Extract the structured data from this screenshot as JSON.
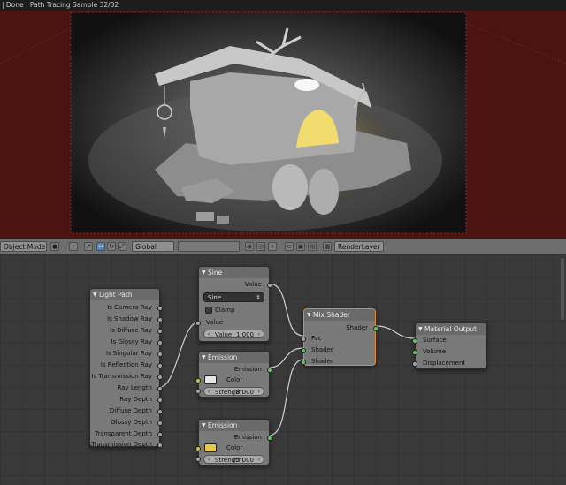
{
  "status_bar": {
    "text": "| Done | Path Tracing Sample 32/32"
  },
  "header": {
    "mode": "Object Mode",
    "orientation": "Global",
    "render_layer": "RenderLayer"
  },
  "nodes": {
    "light_path": {
      "title": "Light Path",
      "outputs": [
        "Is Camera Ray",
        "Is Shadow Ray",
        "Is Diffuse Ray",
        "Is Glossy Ray",
        "Is Singular Ray",
        "Is Reflection Ray",
        "Is Transmission Ray",
        "Ray Length",
        "Ray Depth",
        "Diffuse Depth",
        "Glossy Depth",
        "Transparent Depth",
        "Transmission Depth"
      ]
    },
    "sine": {
      "title": "Sine",
      "output_label": "Value",
      "operation": "Sine",
      "clamp_label": "Clamp",
      "input_label": "Value",
      "value_label": "Value:",
      "value": "1.000"
    },
    "emission1": {
      "title": "Emission",
      "output_label": "Emission",
      "color_label": "Color",
      "strength_label": "Strength:",
      "strength": "8.000",
      "color": "#e6e6e6"
    },
    "emission2": {
      "title": "Emission",
      "output_label": "Emission",
      "color_label": "Color",
      "strength_label": "Strength:",
      "strength": "25.000",
      "color": "#e8c84a"
    },
    "mix_shader": {
      "title": "Mix Shader",
      "output_label": "Shader",
      "inputs": [
        "Fac",
        "Shader",
        "Shader"
      ]
    },
    "material_output": {
      "title": "Material Output",
      "inputs": [
        "Surface",
        "Volume",
        "Displacement"
      ]
    }
  },
  "colors": {
    "viewport_bg": "#4a1410",
    "selected_border": "#e08a2a",
    "shader_socket": "#63c763",
    "value_socket": "#a1a1a1",
    "color_socket": "#c7c729"
  }
}
